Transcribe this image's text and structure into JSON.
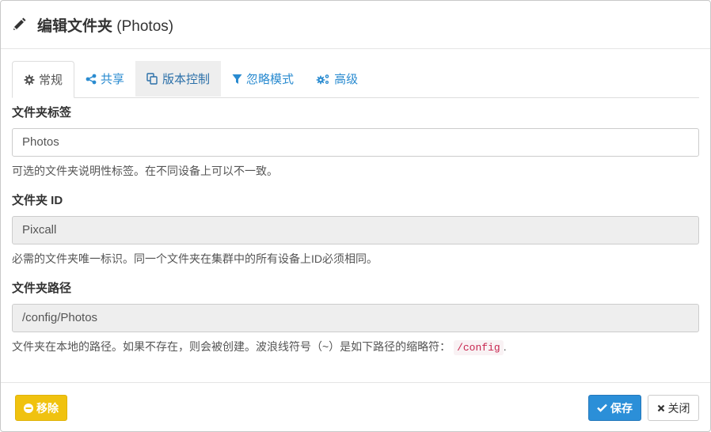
{
  "dialog": {
    "title_prefix": "编辑文件夹",
    "title_suffix": " (Photos)",
    "pencil_icon": "pencil-icon"
  },
  "tabs": [
    {
      "label": "常规",
      "icon": "gear-icon",
      "active": true
    },
    {
      "label": "共享",
      "icon": "share-icon"
    },
    {
      "label": "版本控制",
      "icon": "copy-icon"
    },
    {
      "label": "忽略模式",
      "icon": "filter-icon"
    },
    {
      "label": "高级",
      "icon": "cogs-icon"
    }
  ],
  "fields": {
    "label": {
      "label": "文件夹标签",
      "value": "Photos",
      "help": "可选的文件夹说明性标签。在不同设备上可以不一致。"
    },
    "id": {
      "label": "文件夹 ID",
      "value": "Pixcall",
      "help": "必需的文件夹唯一标识。同一个文件夹在集群中的所有设备上ID必须相同。"
    },
    "path": {
      "label": "文件夹路径",
      "value": "/config/Photos",
      "help": "文件夹在本地的路径。如果不存在，则会被创建。波浪线符号（~）是如下路径的缩略符：",
      "help_code": "/config",
      "help_end": "."
    }
  },
  "footer": {
    "remove_label": "移除",
    "save_label": "保存",
    "close_label": "关闭"
  },
  "colors": {
    "link": "#2a8bd0",
    "save": "#2b8fd8",
    "remove": "#f0c20f",
    "readonly_bg": "#eeeeee"
  }
}
